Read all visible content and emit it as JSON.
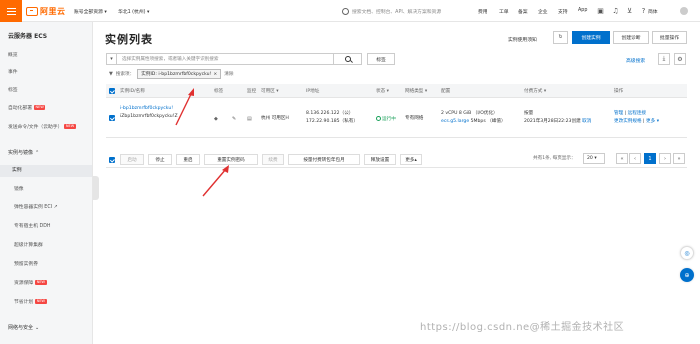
{
  "topbar": {
    "logo": "阿里云",
    "workbench": "账号全部资源",
    "workbench_arrow": "▾",
    "region": "华北1 (杭州)",
    "region_arrow": "▾",
    "search_placeholder": "搜索文档、控制台、API、解决方案和资源",
    "links": [
      "费用",
      "工单",
      "备案",
      "企业",
      "支持",
      "App"
    ],
    "lang": "简体"
  },
  "sidebar": {
    "title": "云服务器 ECS",
    "items": [
      {
        "label": "概览"
      },
      {
        "label": "事件"
      },
      {
        "label": "标签"
      },
      {
        "label": "自动化部署",
        "badge": "NEW"
      },
      {
        "label": "发送命令/文件（云助手）",
        "badge": "NEW"
      }
    ],
    "group1": "实例与镜像",
    "group1_items": [
      {
        "label": "实例",
        "active": true
      },
      {
        "label": "镜像"
      },
      {
        "label": "弹性容器实例 ECI ↗"
      },
      {
        "label": "专有宿主机 DDH"
      },
      {
        "label": "超级计算集群"
      },
      {
        "label": "预留实例券"
      },
      {
        "label": "资源保障",
        "badge": "NEW"
      },
      {
        "label": "节省计划",
        "badge": "NEW"
      }
    ],
    "group2": "网络与安全"
  },
  "main": {
    "title": "实例列表",
    "header_link": "实例使用须知",
    "refresh": "↻",
    "create_button": "创建实例",
    "diagnose_button": "创建诊断",
    "batch_button": "批量操作",
    "search_placeholder": "选择实例属性项搜索，或者输入关键字识别搜索",
    "search_select_arrow": "▾",
    "tag_button": "标签",
    "advanced_search": "高级搜索",
    "filter_label": "搜索项：",
    "filter_chip": "实例ID: i-bp1bzmrfbf0ckpycku!",
    "filter_chip_close": "×",
    "filter_clear": "清除"
  },
  "table": {
    "headers": [
      "实例ID/名称",
      "标签",
      "监控",
      "可用区",
      "IP地址",
      "状态",
      "网络类型",
      "配置",
      "付费方式",
      "操作"
    ],
    "header_arrows": "▾",
    "row": {
      "id": "i-bp1bzmrfbf0ckpycku!",
      "name": "iZbp1bzmrfbf0ckpycku!Z",
      "zone": "杭州 可用区H",
      "ip_public": "8.136.226.122（公）",
      "ip_private": "172.22.90.185（私有）",
      "status": "运行中",
      "network": "专有网络",
      "config_line1": "2 vCPU 8 GiB （I/O优化）",
      "config_line2_type": "ecs.g5.large",
      "config_line2_bw": "5Mbps",
      "config_line2_suffix": "（峰值）",
      "billing_line1": "按量",
      "billing_line2": "2021年3月28日22:23创建",
      "billing_line2_link": "取消",
      "action_manage": "管理",
      "action_remote": "远程连接",
      "action_change": "更改实例规格",
      "action_more": "更多 ▾"
    },
    "batch_actions": [
      "启动",
      "停止",
      "重启",
      "重置实例密码",
      "续费",
      "按量付费转包年包月",
      "释放设置",
      "更多▴"
    ],
    "pagination_info": "共有1条, 每页显示：",
    "page_size": "20",
    "page_size_arrow": "▾",
    "pages": [
      "«",
      "‹",
      "1",
      "›",
      "»"
    ]
  },
  "float": {
    "icon1": "◎",
    "icon2": "⊕"
  },
  "watermark": "https://blog.csdn.ne@稀土掘金技术社区",
  "colors": {
    "brand": "#ff6a00",
    "primary": "#0070cc",
    "running": "#1aa15a",
    "arrow": "#e03030"
  }
}
